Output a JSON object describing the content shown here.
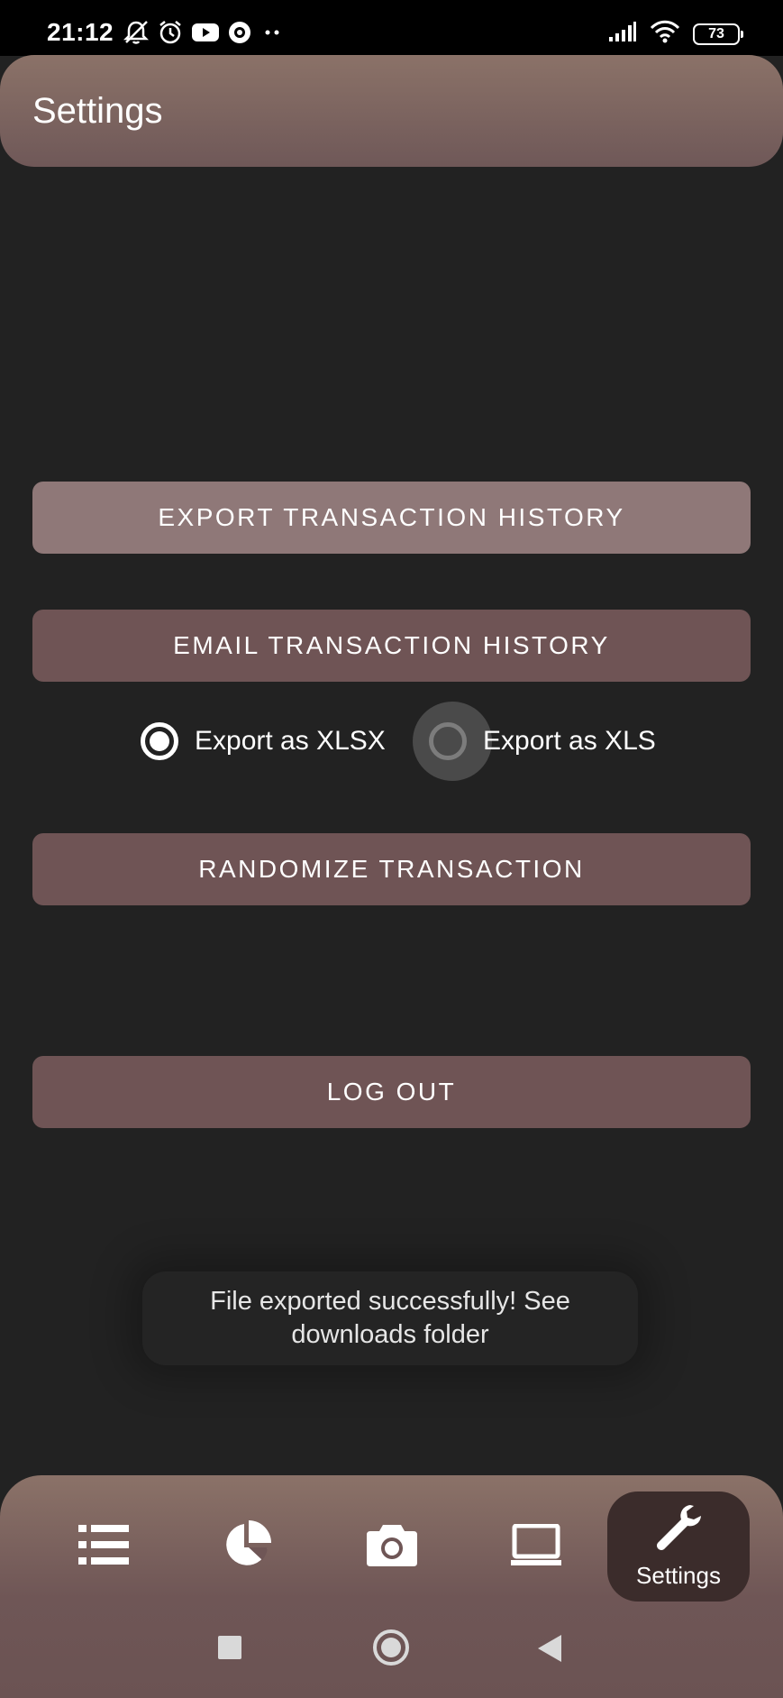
{
  "status_bar": {
    "time": "21:12",
    "left_icons": [
      "mute-icon",
      "alarm-icon",
      "youtube-icon",
      "location-icon",
      "more-dots-icon"
    ],
    "right_icons": [
      "signal-icon",
      "wifi-icon",
      "battery-icon"
    ],
    "battery_level": "73"
  },
  "app_bar": {
    "title": "Settings"
  },
  "actions": {
    "export_label": "EXPORT TRANSACTION HISTORY",
    "email_label": "EMAIL TRANSACTION HISTORY",
    "randomize_label": "RANDOMIZE TRANSACTION",
    "logout_label": "LOG OUT"
  },
  "export_format": {
    "options": [
      {
        "label": "Export as XLSX",
        "selected": true
      },
      {
        "label": "Export as XLS",
        "selected": false
      }
    ]
  },
  "toast": {
    "line1": "File exported successfully! See",
    "line2": "downloads folder"
  },
  "bottom_nav": {
    "items": [
      {
        "icon": "list-icon",
        "label": ""
      },
      {
        "icon": "pie-chart-icon",
        "label": ""
      },
      {
        "icon": "camera-icon",
        "label": ""
      },
      {
        "icon": "laptop-icon",
        "label": ""
      },
      {
        "icon": "wrench-icon",
        "label": "Settings",
        "active": true
      }
    ]
  },
  "system_nav": [
    "recents-icon",
    "home-icon",
    "back-icon"
  ],
  "colors": {
    "background": "#222222",
    "app_bar": "#7c6562",
    "button": "#6f5455",
    "button_primary": "#8f7878",
    "nav_active": "#3b2c2b"
  }
}
